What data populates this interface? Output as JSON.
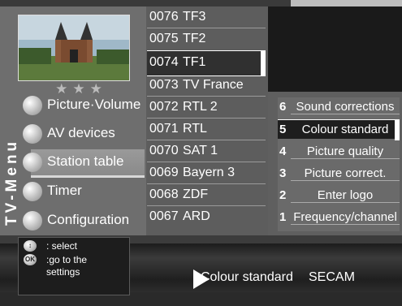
{
  "menu": {
    "title": "TV-Menu",
    "rating_stars": "★★★",
    "items": [
      {
        "label": "Picture·Volume"
      },
      {
        "label": "AV devices"
      },
      {
        "label": "Station table"
      },
      {
        "label": "Timer"
      },
      {
        "label": "Configuration"
      }
    ]
  },
  "channels": [
    {
      "number": "0076",
      "name": "TF3"
    },
    {
      "number": "0075",
      "name": "TF2"
    },
    {
      "number": "0074",
      "name": "TF1"
    },
    {
      "number": "0073",
      "name": "TV France"
    },
    {
      "number": "0072",
      "name": "RTL 2"
    },
    {
      "number": "0071",
      "name": "RTL"
    },
    {
      "number": "0070",
      "name": "SAT 1"
    },
    {
      "number": "0069",
      "name": "Bayern 3"
    },
    {
      "number": "0068",
      "name": "ZDF"
    },
    {
      "number": "0067",
      "name": "ARD"
    }
  ],
  "options": [
    {
      "number": "6",
      "label": "Sound corrections"
    },
    {
      "number": "5",
      "label": "Colour standard"
    },
    {
      "number": "4",
      "label": "Picture quality"
    },
    {
      "number": "3",
      "label": "Picture correct."
    },
    {
      "number": "2",
      "label": "Enter logo"
    },
    {
      "number": "1",
      "label": "Frequency/channel"
    }
  ],
  "help": {
    "line1": ": select",
    "line2": ":go to the",
    "line3": "settings",
    "ok_icon": "OK"
  },
  "status": {
    "label": "Colour standard",
    "value": "SECAM"
  },
  "colors": {
    "panel_gray": "#6e6e6e",
    "list_gray": "#5d5d5d",
    "selection_dark": "#303030",
    "text": "#ffffff"
  }
}
